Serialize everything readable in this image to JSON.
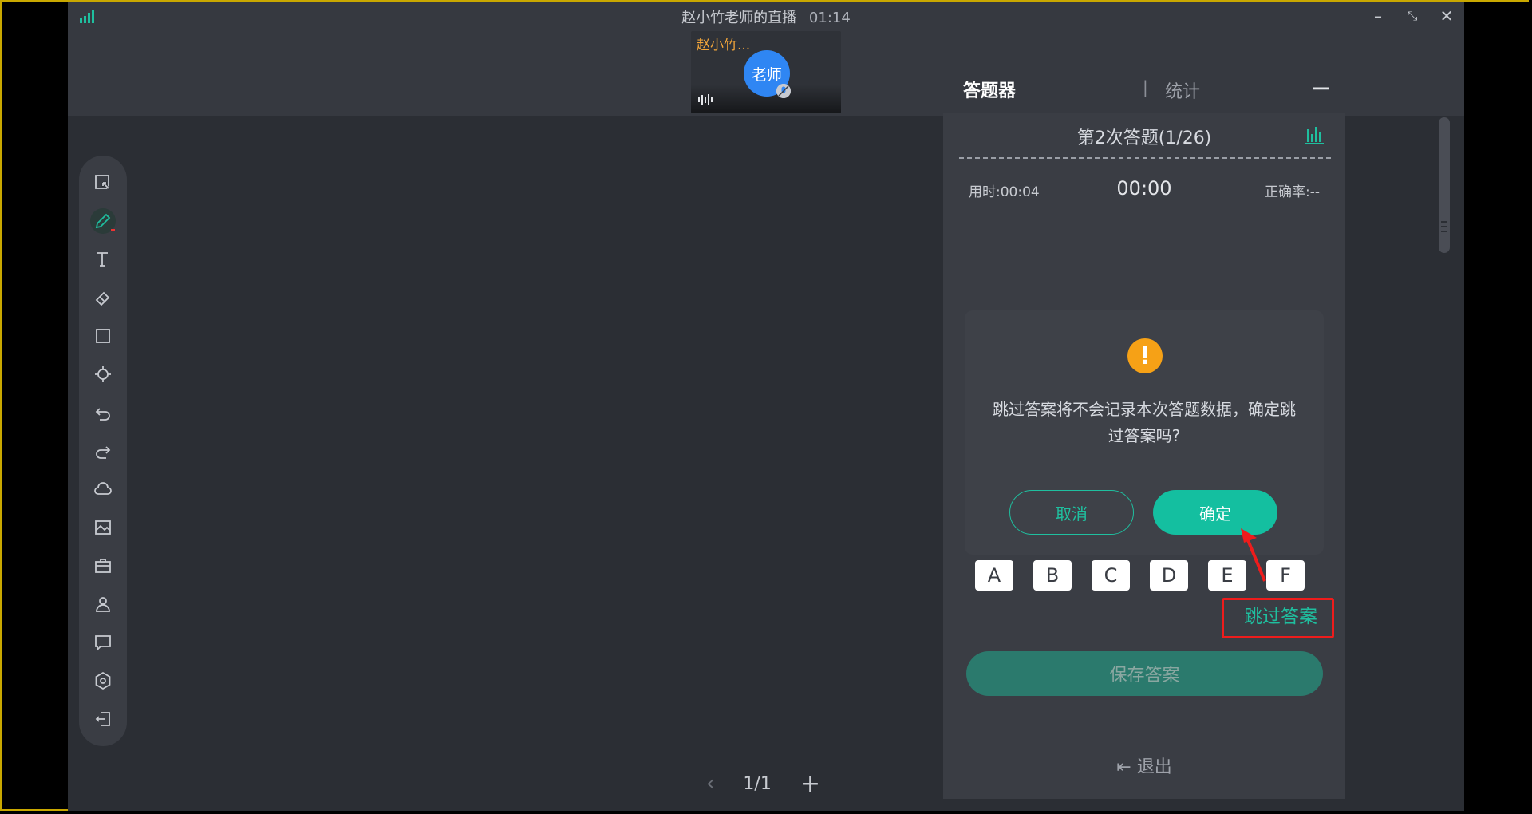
{
  "window": {
    "title": "赵小竹老师的直播",
    "elapsed": "01:14"
  },
  "video": {
    "name": "赵小竹...",
    "avatar_label": "老师"
  },
  "toolbar": {
    "tools": [
      "select",
      "pen",
      "text",
      "eraser",
      "shape",
      "laser-pointer",
      "undo",
      "redo",
      "cloud-drive",
      "image",
      "toolbox",
      "students",
      "chat",
      "settings",
      "exit"
    ]
  },
  "pager": {
    "page": "1/1",
    "prev": "‹",
    "add": "+"
  },
  "panel": {
    "tab_answer": "答题器",
    "tab_sep": "|",
    "tab_stats": "统计",
    "minimize": "−",
    "round_title": "第2次答题(1/26)",
    "used_time": "用时:00:04",
    "timer": "00:00",
    "accuracy": "正确率:--",
    "options": [
      "A",
      "B",
      "C",
      "D",
      "E",
      "F"
    ],
    "skip_label": "跳过答案",
    "save_label": "保存答案",
    "exit_label": "退出"
  },
  "dialog": {
    "icon": "!",
    "message": "跳过答案将不会记录本次答题数据，确定跳过答案吗?",
    "cancel_label": "取消",
    "confirm_label": "确定"
  },
  "colors": {
    "accent": "#14bfa0",
    "warning": "#f6a116",
    "highlight": "#ee1c1c",
    "avatar": "#2f86f3",
    "name": "#f3a63a"
  }
}
